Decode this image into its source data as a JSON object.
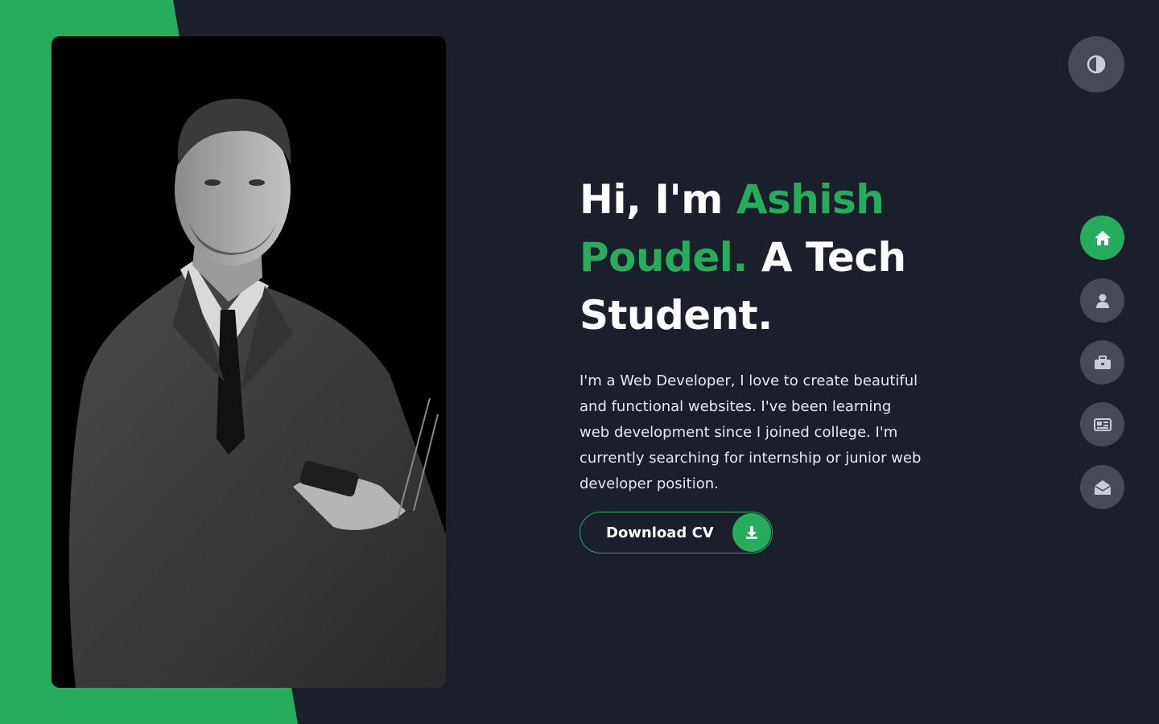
{
  "colors": {
    "background": "#1b1e2b",
    "accent": "#25ad5c",
    "button_gray": "#454a57",
    "text": "#ffffff"
  },
  "hero": {
    "greeting": "Hi, I'm",
    "name_first": "Ashish",
    "name_last": "Poudel.",
    "tagline_1": "A Tech",
    "tagline_2": "Student.",
    "intro": "I'm a Web Developer, I love to create beautiful and functional websites. I've been learning web development since I joined college. I'm currently searching for internship or junior web developer position."
  },
  "cv_button": {
    "label": "Download CV",
    "icon": "download-icon"
  },
  "theme_toggle": {
    "icon": "half-circle-contrast-icon"
  },
  "side_nav": {
    "items": [
      {
        "name": "home",
        "icon": "home-icon",
        "active": true
      },
      {
        "name": "about",
        "icon": "user-icon",
        "active": false
      },
      {
        "name": "portfolio",
        "icon": "briefcase-icon",
        "active": false
      },
      {
        "name": "blog",
        "icon": "newspaper-icon",
        "active": false
      },
      {
        "name": "contact",
        "icon": "envelope-open-icon",
        "active": false
      }
    ]
  },
  "profile_photo": {
    "icon": "portrait-photo"
  }
}
